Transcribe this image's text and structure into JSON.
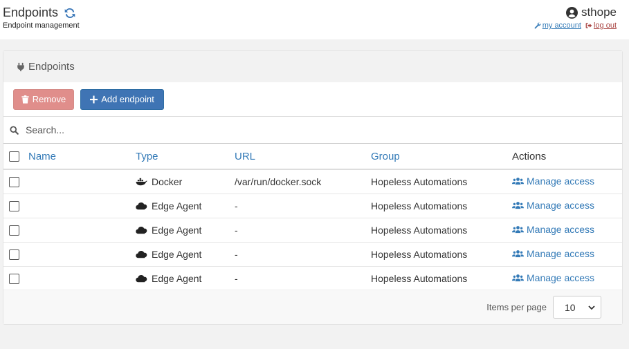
{
  "header": {
    "title": "Endpoints",
    "subtitle": "Endpoint management",
    "refresh_icon": "refresh-icon",
    "username": "sthope",
    "my_account": "my account",
    "log_out": "log out"
  },
  "panel": {
    "title": "Endpoints",
    "remove_label": "Remove",
    "add_label": "Add endpoint",
    "search_placeholder": "Search..."
  },
  "table": {
    "columns": {
      "name": "Name",
      "type": "Type",
      "url": "URL",
      "group": "Group",
      "actions": "Actions"
    },
    "rows": [
      {
        "name": "",
        "type": "Docker",
        "type_icon": "docker-icon",
        "url": "/var/run/docker.sock",
        "group": "Hopeless Automations",
        "action": "Manage access"
      },
      {
        "name": "",
        "type": "Edge Agent",
        "type_icon": "cloud-icon",
        "url": "-",
        "group": "Hopeless Automations",
        "action": "Manage access"
      },
      {
        "name": "",
        "type": "Edge Agent",
        "type_icon": "cloud-icon",
        "url": "-",
        "group": "Hopeless Automations",
        "action": "Manage access"
      },
      {
        "name": "",
        "type": "Edge Agent",
        "type_icon": "cloud-icon",
        "url": "-",
        "group": "Hopeless Automations",
        "action": "Manage access"
      },
      {
        "name": "",
        "type": "Edge Agent",
        "type_icon": "cloud-icon",
        "url": "-",
        "group": "Hopeless Automations",
        "action": "Manage access"
      }
    ]
  },
  "pagination": {
    "items_per_page_label": "Items per page",
    "items_per_page_value": "10"
  },
  "colors": {
    "link": "#337ab7",
    "remove": "#e08e8b",
    "add": "#3f74b4",
    "logout": "#a94442"
  }
}
